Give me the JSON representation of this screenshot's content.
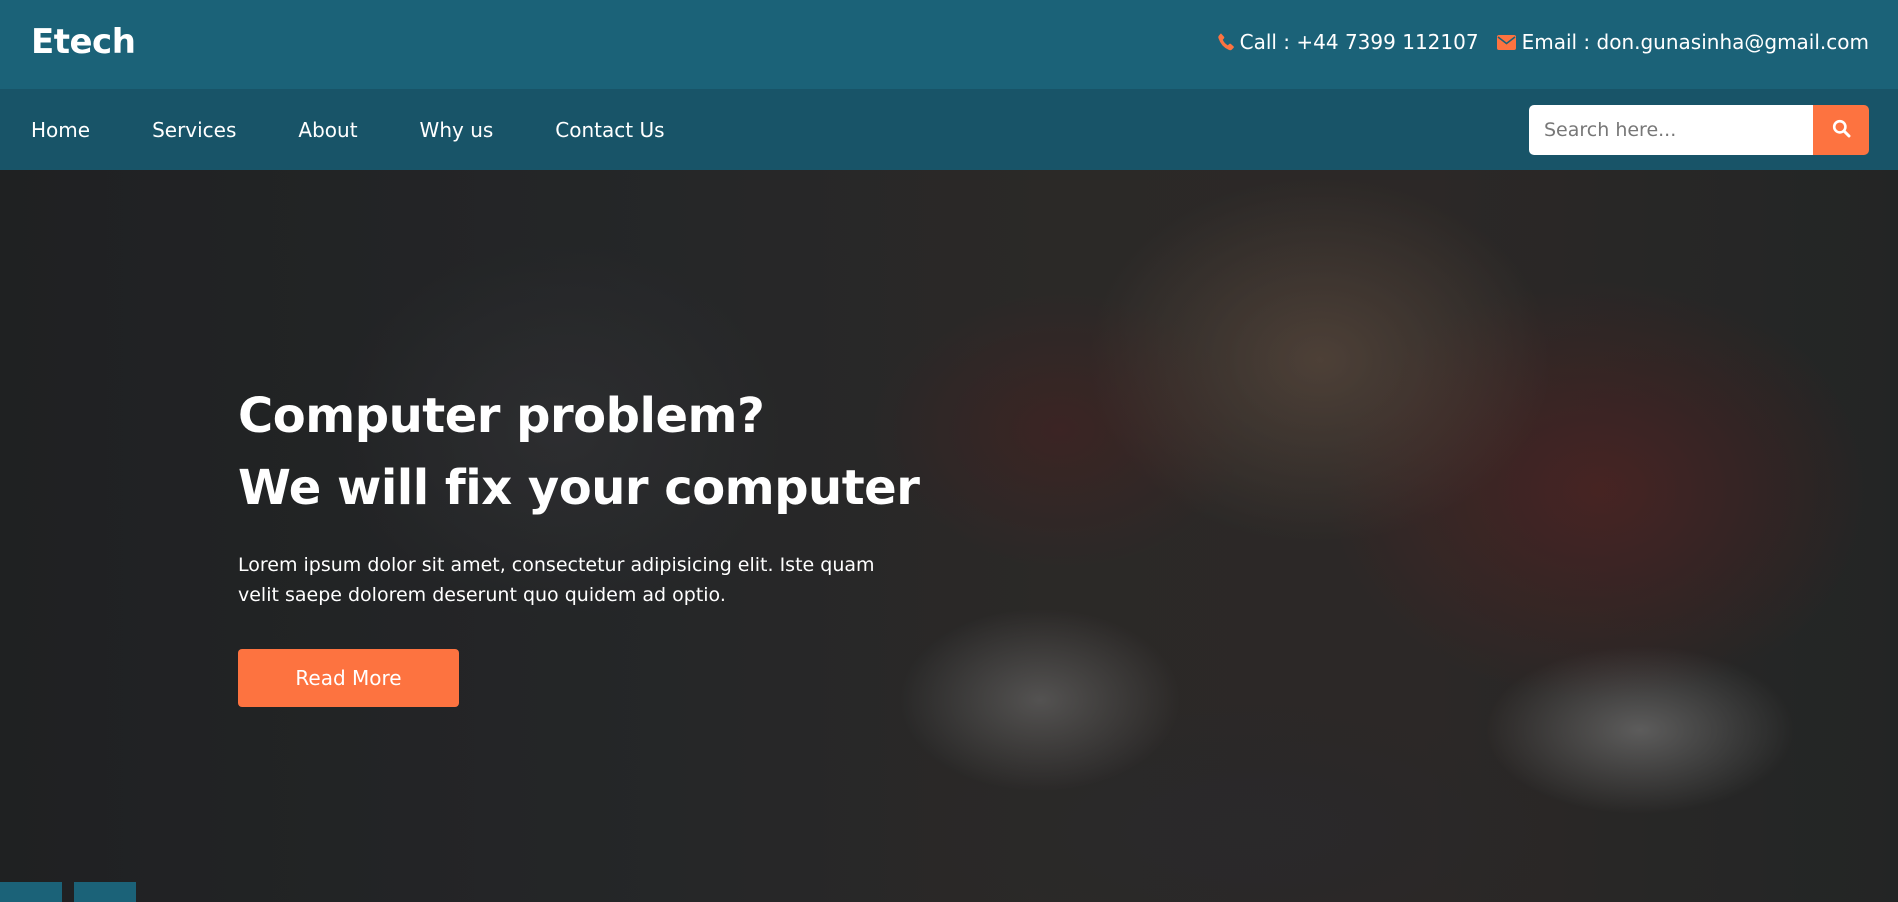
{
  "brand": "Etech",
  "contact": {
    "call_label": "Call : +44 7399 112107",
    "email_label": "Email : don.gunasinha@gmail.com",
    "call_icon": "phone-icon",
    "email_icon": "envelope-icon"
  },
  "nav": {
    "items": [
      {
        "label": "Home"
      },
      {
        "label": "Services"
      },
      {
        "label": "About"
      },
      {
        "label": "Why us"
      },
      {
        "label": "Contact Us"
      }
    ]
  },
  "search": {
    "placeholder": "Search here...",
    "value": "",
    "button_icon": "search-icon"
  },
  "hero": {
    "title_line1": "Computer problem?",
    "title_line2": "We will fix your computer",
    "text": "Lorem ipsum dolor sit amet, consectetur adipisicing elit. Iste quam velit saepe dolorem deserunt quo quidem ad optio.",
    "button_label": "Read More"
  },
  "slider": {
    "dots": 2
  },
  "colors": {
    "topbar": "#1b6278",
    "navbar": "#185468",
    "accent": "#fd7340",
    "text": "#ffffff"
  }
}
